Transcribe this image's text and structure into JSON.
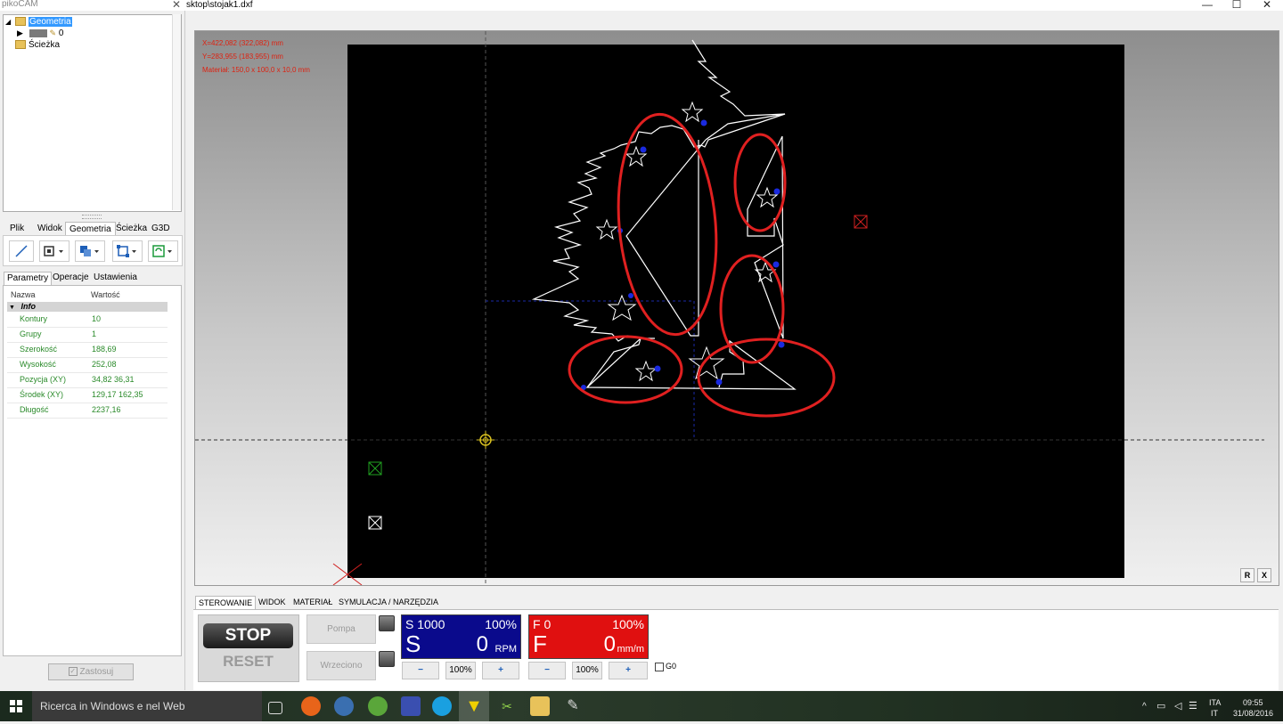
{
  "window": {
    "app_title": "pikoCAM",
    "file_title": "sktop\\stojak1.dxf",
    "panel_close": "✕",
    "minimize": "—",
    "maximize": "☐",
    "close": "✕"
  },
  "tree": {
    "root_label": "Geometria",
    "layer_label": "0",
    "path_label": "Ścieżka"
  },
  "menu_tabs": [
    "Plik",
    "Widok",
    "Geometria",
    "Ścieżka",
    "G3D"
  ],
  "menu_active": "Geometria",
  "tools": [
    {
      "icon": "line-icon"
    },
    {
      "icon": "frame-icon"
    },
    {
      "icon": "boolean-icon"
    },
    {
      "icon": "transform-icon"
    },
    {
      "icon": "refresh-icon"
    }
  ],
  "prop_tabs": [
    "Parametry",
    "Operacje",
    "Ustawienia"
  ],
  "prop_headers": {
    "name": "Nazwa",
    "value": "Wartość"
  },
  "prop_category": "Info",
  "properties": [
    {
      "key": "Kontury",
      "value": "10"
    },
    {
      "key": "Grupy",
      "value": "1"
    },
    {
      "key": "Szerokość",
      "value": "188,69"
    },
    {
      "key": "Wysokość",
      "value": "252,08"
    },
    {
      "key": "Pozycja (XY)",
      "value": "34,82  36,31"
    },
    {
      "key": "Środek (XY)",
      "value": "129,17  162,35"
    },
    {
      "key": "Długość",
      "value": "2237,16"
    }
  ],
  "apply_label": "Zastosuj",
  "viewport": {
    "coord_x": "X=422,082 (322,082) mm",
    "coord_y": "Y=283,955 (183,955) mm",
    "material": "Materiał: 150,0 x 100,0 x 10,0 mm",
    "r_btn": "R",
    "x_btn": "X"
  },
  "bottom_tabs": [
    "STEROWANIE",
    "WIDOK",
    "MATERIAŁ",
    "SYMULACJA / NARZĘDZIA"
  ],
  "bottom_active": "STEROWANIE",
  "control": {
    "stop": "STOP",
    "reset": "RESET",
    "pompa": "Pompa",
    "wrzeciono": "Wrzeciono",
    "spindle": {
      "label": "S 1000",
      "percent": "100%",
      "letter": "S",
      "value": "0",
      "unit": "RPM",
      "color": "#0a0a8c"
    },
    "feed": {
      "label": "F 0",
      "percent": "100%",
      "letter": "F",
      "value": "0",
      "unit": "mm/m",
      "color": "#e01010"
    },
    "minus": "−",
    "plus": "+",
    "pct": "100%",
    "g0": "G0"
  },
  "taskbar": {
    "search": "Ricerca in Windows e nel Web",
    "lang1": "ITA",
    "lang2": "IT",
    "time": "09:55",
    "date": "31/08/2016"
  }
}
